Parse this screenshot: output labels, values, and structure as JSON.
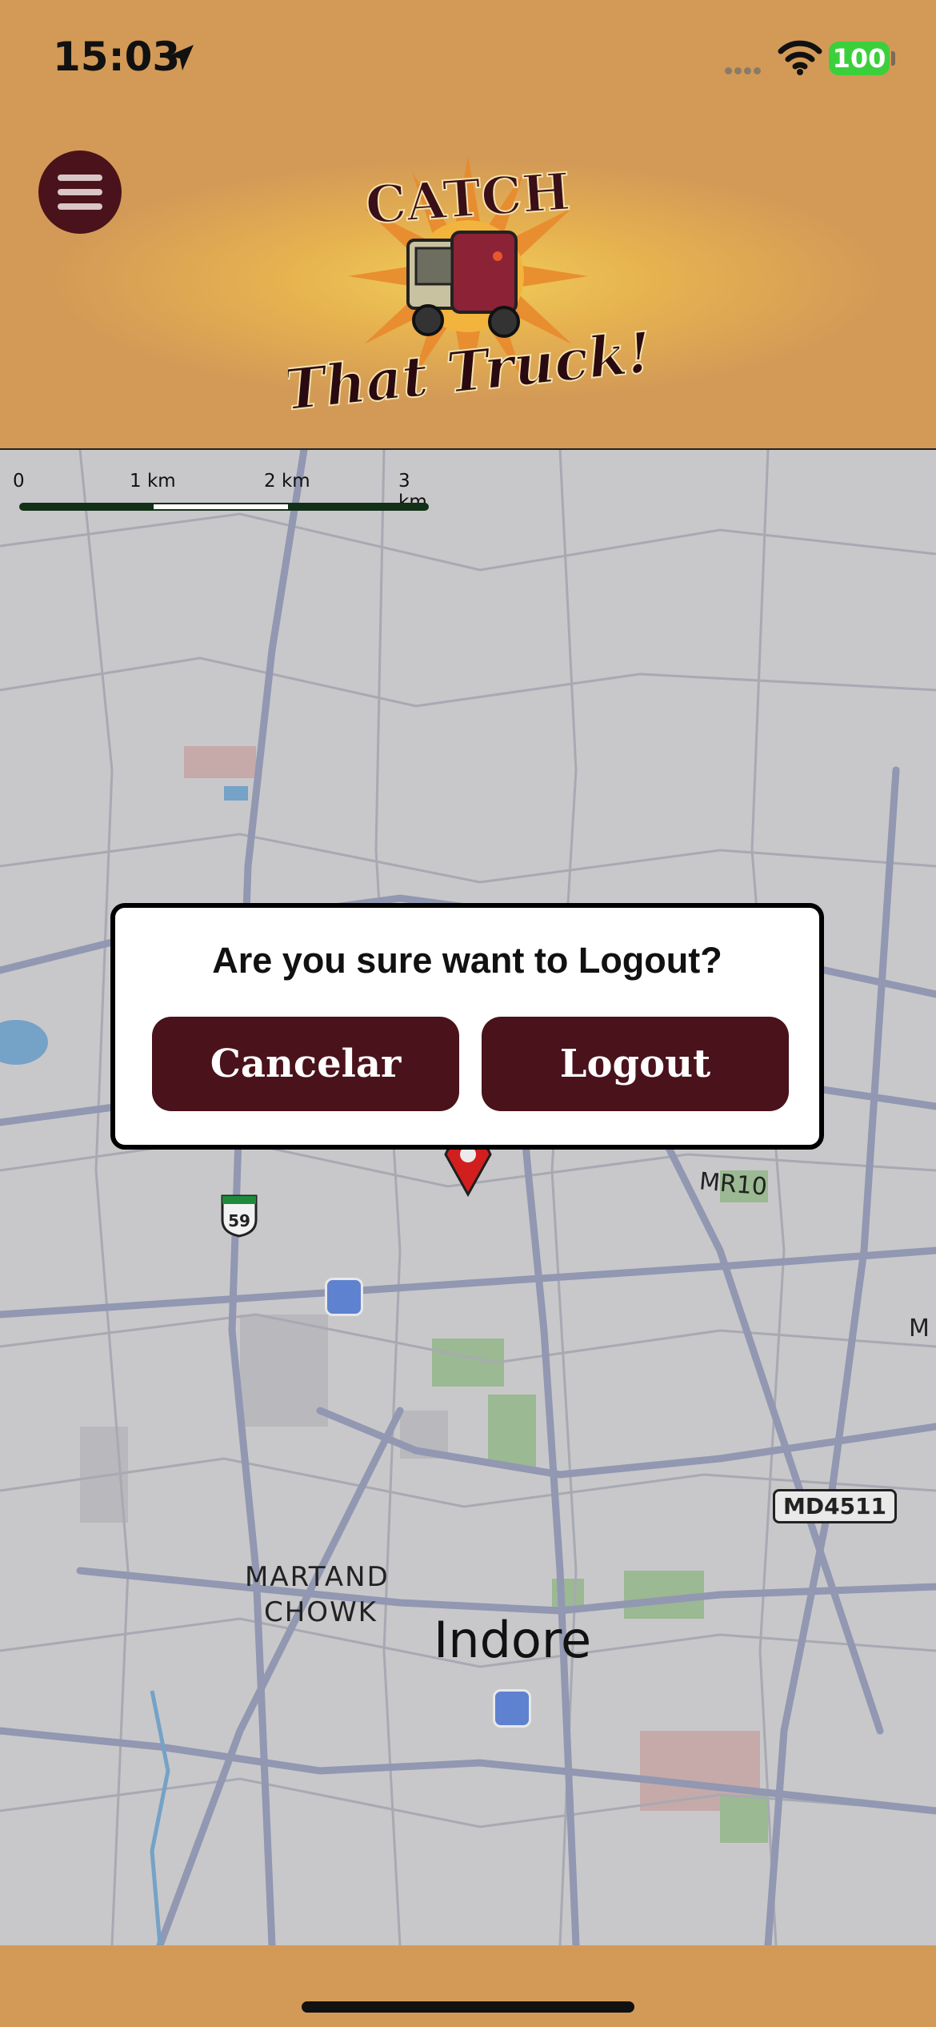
{
  "status_bar": {
    "time": "15:03",
    "battery": "100",
    "icons": [
      "location-arrow-icon",
      "cellular-signal-icon",
      "wifi-icon",
      "battery-icon"
    ]
  },
  "header": {
    "menu_icon": "hamburger-menu-icon",
    "logo_alt": "Catch That Truck! logo",
    "logo_top_text": "CATCH",
    "logo_bottom_text": "That Truck!"
  },
  "map": {
    "scale_labels": [
      "0",
      "1 km",
      "2 km",
      "3 km"
    ],
    "labels": {
      "road_mr10": "MR10",
      "road_m": "M",
      "shield_59": "59",
      "md4511": "MD4511",
      "martand_line1": "MARTAND",
      "martand_line2": "CHOWK",
      "city": "Indore"
    }
  },
  "dialog": {
    "title": "Are you sure want to Logout?",
    "cancel_label": "Cancelar",
    "logout_label": "Logout"
  },
  "colors": {
    "header_bg": "#d39a57",
    "button_bg": "#4a121b",
    "battery_green": "#3bd03b"
  }
}
